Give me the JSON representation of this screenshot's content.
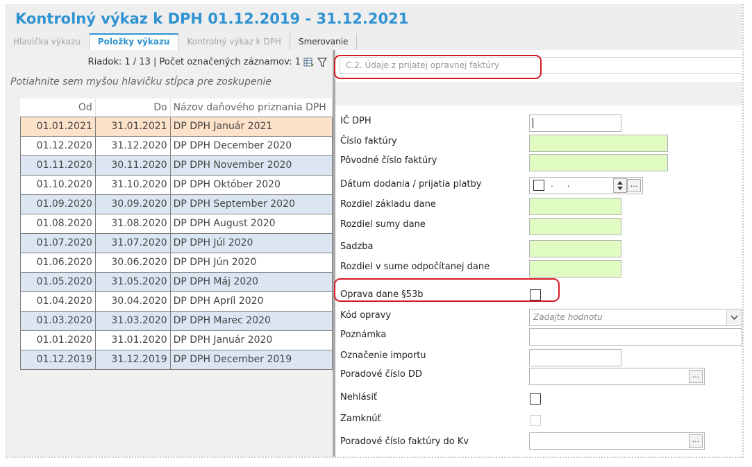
{
  "header": {
    "title": "Kontrolný výkaz k DPH 01.12.2019 - 31.12.2021",
    "tabs": [
      {
        "label": "Hlavička výkazu"
      },
      {
        "label": "Položky výkazu"
      },
      {
        "label": "Kontrolný výkaz k DPH"
      },
      {
        "label": "Smerovanie"
      }
    ]
  },
  "left": {
    "status": "Riadok: 1 / 13 | Počet označených záznamov: 1",
    "group_hint": "Potiahnite sem myšou hlavičku stĺpca pre zoskupenie",
    "columns": [
      "Od",
      "Do",
      "Názov daňového priznania DPH"
    ],
    "rows": [
      {
        "od": "01.01.2021",
        "do": "31.01.2021",
        "nazov": "DP DPH Január 2021"
      },
      {
        "od": "01.12.2020",
        "do": "31.12.2020",
        "nazov": "DP DPH December 2020"
      },
      {
        "od": "01.11.2020",
        "do": "30.11.2020",
        "nazov": "DP DPH November 2020"
      },
      {
        "od": "01.10.2020",
        "do": "31.10.2020",
        "nazov": "DP DPH Október 2020"
      },
      {
        "od": "01.09.2020",
        "do": "30.09.2020",
        "nazov": "DP DPH September 2020"
      },
      {
        "od": "01.08.2020",
        "do": "31.08.2020",
        "nazov": "DP DPH August 2020"
      },
      {
        "od": "01.07.2020",
        "do": "31.07.2020",
        "nazov": "DP DPH Júl 2020"
      },
      {
        "od": "01.06.2020",
        "do": "30.06.2020",
        "nazov": "DP DPH Jún 2020"
      },
      {
        "od": "01.05.2020",
        "do": "31.05.2020",
        "nazov": "DP DPH Máj 2020"
      },
      {
        "od": "01.04.2020",
        "do": "30.04.2020",
        "nazov": "DP DPH Apríl 2020"
      },
      {
        "od": "01.03.2020",
        "do": "31.03.2020",
        "nazov": "DP DPH Marec 2020"
      },
      {
        "od": "01.01.2020",
        "do": "31.01.2020",
        "nazov": "DP DPH Január 2020"
      },
      {
        "od": "01.12.2019",
        "do": "31.12.2019",
        "nazov": "DP DPH December 2019"
      }
    ]
  },
  "right": {
    "section_placeholder": "C.2. Údaje z prijatej opravnej faktúry",
    "labels": {
      "ic_dph": "IČ DPH",
      "cislo_faktury": "Číslo faktúry",
      "povodne_cislo": "Pôvodné číslo faktúry",
      "datum_dodania": "Dátum dodania / prijatia platby",
      "rozdiel_zakladu": "Rozdiel základu dane",
      "rozdiel_sumy": "Rozdiel sumy dane",
      "sadzba": "Sadzba",
      "rozdiel_odpocitanej": "Rozdiel v sume odpočítanej dane",
      "oprava_dane": "Oprava dane §53b",
      "kod_opravy": "Kód opravy",
      "poznamka": "Poznámka",
      "oznacenie_importu": "Označenie importu",
      "poradove_dd": "Poradové číslo DD",
      "nehlasit": "Nehlásiť",
      "zamknut": "Zamknúť",
      "poradove_kv": "Poradové číslo faktúry do Kv"
    },
    "date_value": ". .",
    "kod_opravy_placeholder": "Zadajte hodnotu",
    "ellipsis": "..."
  },
  "colors": {
    "accent": "#2f93d2",
    "selected_row": "#fce2c8",
    "alt_row": "#dbe6f2",
    "required_field": "#e0fcc2",
    "callout": "#d71921"
  }
}
